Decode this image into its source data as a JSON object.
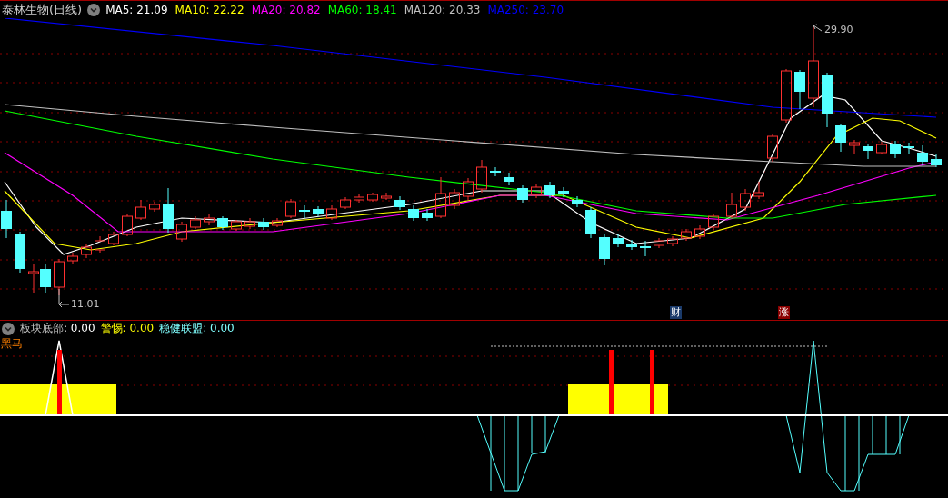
{
  "chart": {
    "title": "泰林生物(日线)",
    "indicators": [
      {
        "label": "MA5: 21.09",
        "color": "#ffffff"
      },
      {
        "label": "MA10: 22.22",
        "color": "#ffff00"
      },
      {
        "label": "MA20: 20.82",
        "color": "#ff00ff"
      },
      {
        "label": "MA60: 18.41",
        "color": "#00ff00"
      },
      {
        "label": "MA120: 20.33",
        "color": "#c0c0c0"
      },
      {
        "label": "MA250: 23.70",
        "color": "#0000ff"
      }
    ],
    "high_label": "29.90",
    "low_label": "11.01",
    "event_markers": [
      {
        "text": "财",
        "color": "#1a3a6a"
      },
      {
        "text": "涨",
        "color": "#8a0000"
      }
    ]
  },
  "subchart": {
    "indicators": [
      {
        "name": "板块底部",
        "value": ": 0.00",
        "kind": "muted",
        "color": "#ffffff"
      },
      {
        "name": "警惕",
        "value": ": 0.00",
        "kind": "plain",
        "color": "#ffff00"
      },
      {
        "name": "稳健联盟",
        "value": ": 0.00",
        "kind": "plain",
        "color": "#80ffff"
      }
    ],
    "legend_label": "黑马"
  }
}
